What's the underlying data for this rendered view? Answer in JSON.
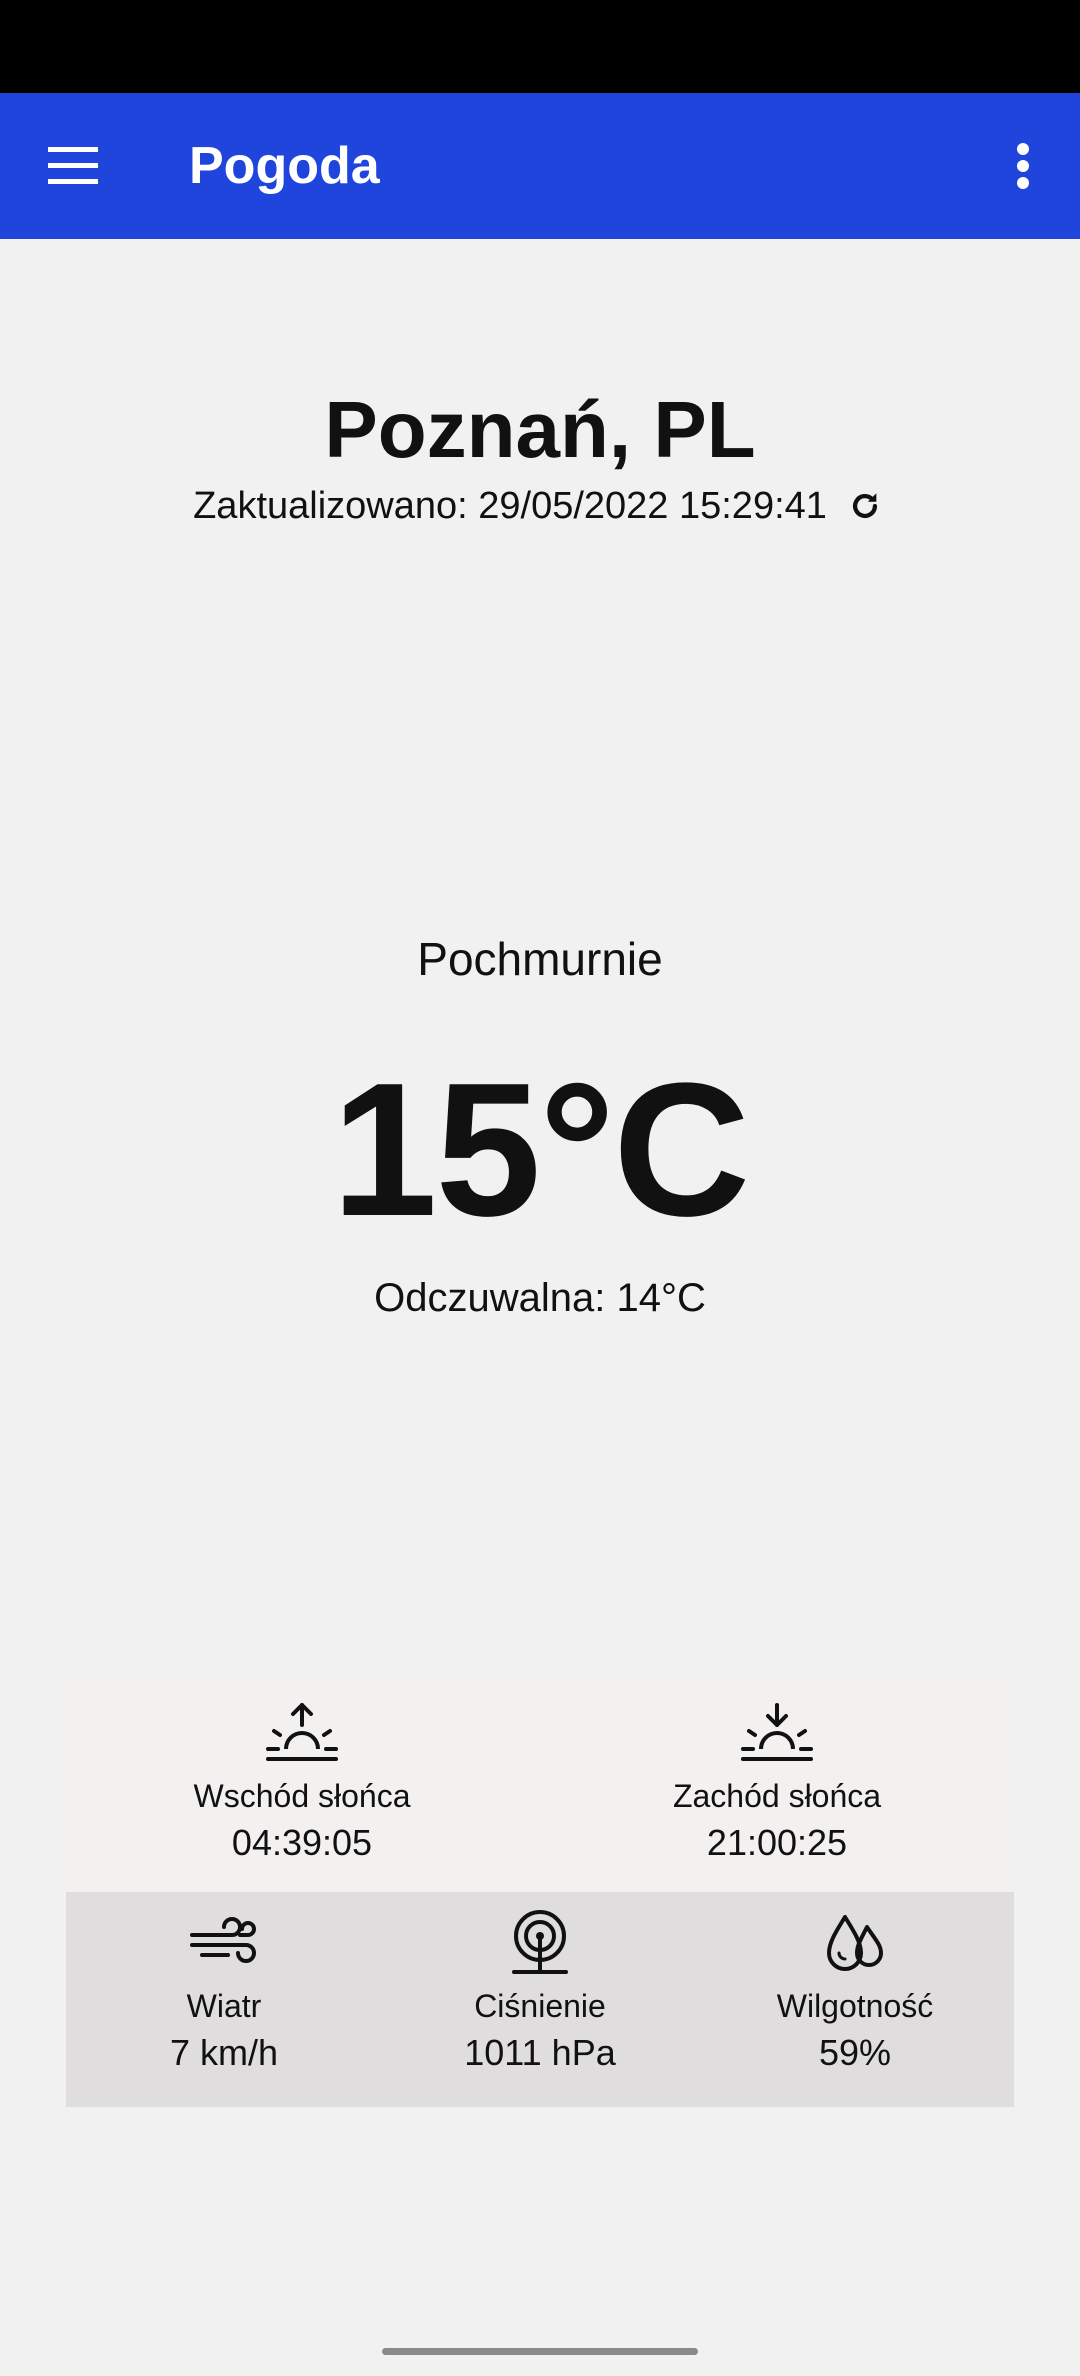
{
  "app_bar": {
    "title": "Pogoda",
    "menu_icon": "hamburger-menu-icon",
    "overflow_icon": "more-vert-icon",
    "color": "#1f45dc"
  },
  "location": {
    "city": "Poznań, PL",
    "updated": "Zaktualizowano: 29/05/2022 15:29:41",
    "refresh_icon": "refresh-icon"
  },
  "current": {
    "condition": "Pochmurnie",
    "temperature": "15°C",
    "feels_like": "Odczuwalna: 14°C"
  },
  "sun": {
    "sunrise": {
      "label": "Wschód słońca",
      "value": "04:39:05",
      "icon": "sunrise-icon"
    },
    "sunset": {
      "label": "Zachód słońca",
      "value": "21:00:25",
      "icon": "sunset-icon"
    }
  },
  "details": {
    "wind": {
      "label": "Wiatr",
      "value": "7 km/h",
      "icon": "wind-icon"
    },
    "pressure": {
      "label": "Ciśnienie",
      "value": "1011 hPa",
      "icon": "pressure-gauge-icon"
    },
    "humidity": {
      "label": "Wilgotność",
      "value": "59%",
      "icon": "humidity-drops-icon"
    }
  },
  "colors": {
    "background": "#f2f1f1",
    "sun_panel": "#f3f0f0",
    "details_panel": "#dfdddd"
  }
}
